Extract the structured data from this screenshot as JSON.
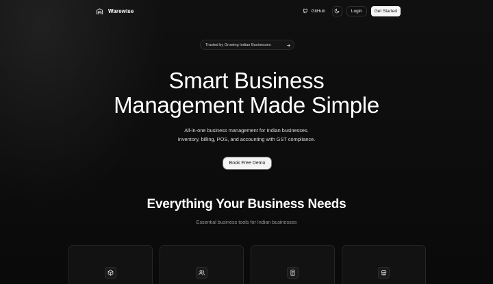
{
  "nav": {
    "brand": "Warewise",
    "github_label": "GitHub",
    "login_label": "Login",
    "get_started_label": "Get Started"
  },
  "badge": {
    "text": "Trusted by Growing Indian Businesses"
  },
  "hero": {
    "title_line1": "Smart Business",
    "title_line2": "Management Made Simple",
    "subtitle_line1": "All-in-one business management for Indian businesses.",
    "subtitle_line2": "Inventory, billing, POS, and accounting with GST compliance.",
    "cta_label": "Book Free Demo"
  },
  "features": {
    "title": "Everything Your Business Needs",
    "subtitle": "Essential business tools for Indian businesses",
    "cards": [
      {
        "icon": "package-icon"
      },
      {
        "icon": "users-icon"
      },
      {
        "icon": "receipt-icon"
      },
      {
        "icon": "store-icon"
      }
    ]
  },
  "colors": {
    "background": "#0b0b0b",
    "text": "#ffffff",
    "muted": "#9a9a9a",
    "button_light": "#f5f5f5",
    "border": "#2b2b2b"
  }
}
